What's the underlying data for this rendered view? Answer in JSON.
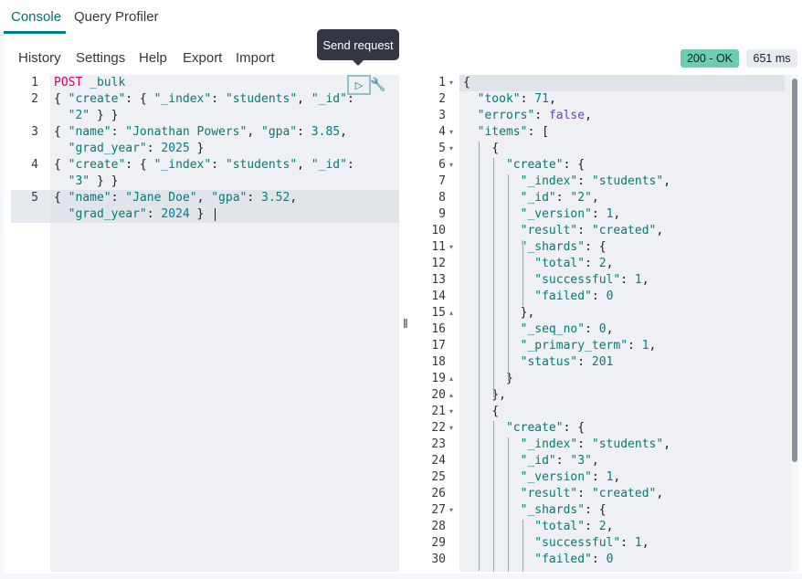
{
  "tabs": [
    {
      "label": "Console"
    },
    {
      "label": "Query Profiler"
    }
  ],
  "menu": [
    "History",
    "Settings",
    "Help",
    "Export",
    "Import"
  ],
  "tooltip": "Send request",
  "status": {
    "code": "200 - OK",
    "time": "651 ms"
  },
  "request_lines": [
    {
      "num": "1",
      "html": "<span class=\"kw\">POST</span> <span class=\"n\">_bulk</span>"
    },
    {
      "num": "2",
      "html": "<span class=\"k\">{ </span><span class=\"s\">\"create\"</span><span class=\"k\">: { </span><span class=\"s\">\"_index\"</span><span class=\"k\">: </span><span class=\"s\">\"students\"</span><span class=\"k\">, </span><span class=\"s\">\"_id\"</span><span class=\"k\">:</span>"
    },
    {
      "num": "",
      "html": "  <span class=\"s\">\"2\"</span><span class=\"k\"> } }</span>"
    },
    {
      "num": "3",
      "html": "<span class=\"k\">{ </span><span class=\"s\">\"name\"</span><span class=\"k\">: </span><span class=\"s\">\"Jonathan Powers\"</span><span class=\"k\">, </span><span class=\"s\">\"gpa\"</span><span class=\"k\">: </span><span class=\"n\">3.85</span><span class=\"k\">,</span>"
    },
    {
      "num": "",
      "html": "  <span class=\"s\">\"grad_year\"</span><span class=\"k\">: </span><span class=\"n\">2025</span><span class=\"k\"> }</span>"
    },
    {
      "num": "4",
      "html": "<span class=\"k\">{ </span><span class=\"s\">\"create\"</span><span class=\"k\">: { </span><span class=\"s\">\"_index\"</span><span class=\"k\">: </span><span class=\"s\">\"students\"</span><span class=\"k\">, </span><span class=\"s\">\"_id\"</span><span class=\"k\">:</span>"
    },
    {
      "num": "",
      "html": "  <span class=\"s\">\"3\"</span><span class=\"k\"> } }</span>"
    },
    {
      "num": "5",
      "html": "<span class=\"k\">{ </span><span class=\"s\">\"name\"</span><span class=\"k\">: </span><span class=\"s\">\"Jane Doe\"</span><span class=\"k\">, </span><span class=\"s\">\"gpa\"</span><span class=\"k\">: </span><span class=\"n\">3.52</span><span class=\"k\">,</span>"
    },
    {
      "num": "",
      "html": "  <span class=\"s\">\"grad_year\"</span><span class=\"k\">: </span><span class=\"n\">2024</span><span class=\"k\"> }</span>"
    }
  ],
  "response_lines": [
    {
      "num": "1",
      "fold": "▾",
      "html": "<span class=\"k\">{</span>"
    },
    {
      "num": "2",
      "fold": "",
      "html": "  <span class=\"s\">\"took\"</span><span class=\"k\">: </span><span class=\"n\">71</span><span class=\"k\">,</span>"
    },
    {
      "num": "3",
      "fold": "",
      "html": "  <span class=\"s\">\"errors\"</span><span class=\"k\">: </span><span class=\"b\">false</span><span class=\"k\">,</span>"
    },
    {
      "num": "4",
      "fold": "▾",
      "html": "  <span class=\"s\">\"items\"</span><span class=\"k\">: [</span>"
    },
    {
      "num": "5",
      "fold": "▾",
      "html": "    <span class=\"k\">{</span>"
    },
    {
      "num": "6",
      "fold": "▾",
      "html": "      <span class=\"s\">\"create\"</span><span class=\"k\">: {</span>"
    },
    {
      "num": "7",
      "fold": "",
      "html": "        <span class=\"s\">\"_index\"</span><span class=\"k\">: </span><span class=\"s\">\"students\"</span><span class=\"k\">,</span>"
    },
    {
      "num": "8",
      "fold": "",
      "html": "        <span class=\"s\">\"_id\"</span><span class=\"k\">: </span><span class=\"s\">\"2\"</span><span class=\"k\">,</span>"
    },
    {
      "num": "9",
      "fold": "",
      "html": "        <span class=\"s\">\"_version\"</span><span class=\"k\">: </span><span class=\"n\">1</span><span class=\"k\">,</span>"
    },
    {
      "num": "10",
      "fold": "",
      "html": "        <span class=\"s\">\"result\"</span><span class=\"k\">: </span><span class=\"s\">\"created\"</span><span class=\"k\">,</span>"
    },
    {
      "num": "11",
      "fold": "▾",
      "html": "        <span class=\"s\">\"_shards\"</span><span class=\"k\">: {</span>"
    },
    {
      "num": "12",
      "fold": "",
      "html": "          <span class=\"s\">\"total\"</span><span class=\"k\">: </span><span class=\"n\">2</span><span class=\"k\">,</span>"
    },
    {
      "num": "13",
      "fold": "",
      "html": "          <span class=\"s\">\"successful\"</span><span class=\"k\">: </span><span class=\"n\">1</span><span class=\"k\">,</span>"
    },
    {
      "num": "14",
      "fold": "",
      "html": "          <span class=\"s\">\"failed\"</span><span class=\"k\">: </span><span class=\"n\">0</span>"
    },
    {
      "num": "15",
      "fold": "▴",
      "html": "        <span class=\"k\">},</span>"
    },
    {
      "num": "16",
      "fold": "",
      "html": "        <span class=\"s\">\"_seq_no\"</span><span class=\"k\">: </span><span class=\"n\">0</span><span class=\"k\">,</span>"
    },
    {
      "num": "17",
      "fold": "",
      "html": "        <span class=\"s\">\"_primary_term\"</span><span class=\"k\">: </span><span class=\"n\">1</span><span class=\"k\">,</span>"
    },
    {
      "num": "18",
      "fold": "",
      "html": "        <span class=\"s\">\"status\"</span><span class=\"k\">: </span><span class=\"n\">201</span>"
    },
    {
      "num": "19",
      "fold": "▴",
      "html": "      <span class=\"k\">}</span>"
    },
    {
      "num": "20",
      "fold": "▴",
      "html": "    <span class=\"k\">},</span>"
    },
    {
      "num": "21",
      "fold": "▾",
      "html": "    <span class=\"k\">{</span>"
    },
    {
      "num": "22",
      "fold": "▾",
      "html": "      <span class=\"s\">\"create\"</span><span class=\"k\">: {</span>"
    },
    {
      "num": "23",
      "fold": "",
      "html": "        <span class=\"s\">\"_index\"</span><span class=\"k\">: </span><span class=\"s\">\"students\"</span><span class=\"k\">,</span>"
    },
    {
      "num": "24",
      "fold": "",
      "html": "        <span class=\"s\">\"_id\"</span><span class=\"k\">: </span><span class=\"s\">\"3\"</span><span class=\"k\">,</span>"
    },
    {
      "num": "25",
      "fold": "",
      "html": "        <span class=\"s\">\"_version\"</span><span class=\"k\">: </span><span class=\"n\">1</span><span class=\"k\">,</span>"
    },
    {
      "num": "26",
      "fold": "",
      "html": "        <span class=\"s\">\"result\"</span><span class=\"k\">: </span><span class=\"s\">\"created\"</span><span class=\"k\">,</span>"
    },
    {
      "num": "27",
      "fold": "▾",
      "html": "        <span class=\"s\">\"_shards\"</span><span class=\"k\">: {</span>"
    },
    {
      "num": "28",
      "fold": "",
      "html": "          <span class=\"s\">\"total\"</span><span class=\"k\">: </span><span class=\"n\">2</span><span class=\"k\">,</span>"
    },
    {
      "num": "29",
      "fold": "",
      "html": "          <span class=\"s\">\"successful\"</span><span class=\"k\">: </span><span class=\"n\">1</span><span class=\"k\">,</span>"
    },
    {
      "num": "30",
      "fold": "",
      "html": "          <span class=\"s\">\"failed\"</span><span class=\"k\">: </span><span class=\"n\">0</span>"
    }
  ]
}
